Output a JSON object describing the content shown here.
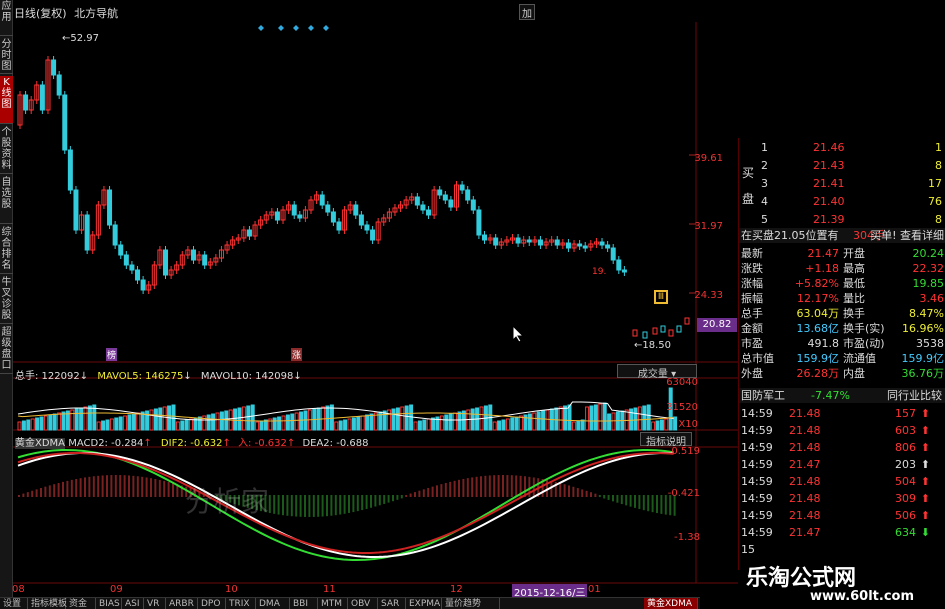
{
  "title": {
    "period": "日线(复权)",
    "stock": "北方导航",
    "right_btn": "加"
  },
  "leftbar": [
    {
      "label": "应用",
      "active": false
    },
    {
      "label": "分时图",
      "active": false
    },
    {
      "label": "K线图",
      "active": true
    },
    {
      "label": "个股资料",
      "active": false
    },
    {
      "label": "自选股",
      "active": false
    },
    {
      "label": "综合排名",
      "active": false
    },
    {
      "label": "牛叉诊股",
      "active": false
    },
    {
      "label": "超级盘口",
      "active": false
    }
  ],
  "price_axis": [
    "39.61",
    "31.97",
    "24.33",
    "20.82"
  ],
  "annotations": {
    "high": "52.97",
    "low": "18.50",
    "tag1": "榜",
    "tag2": "涨",
    "tag3": "19."
  },
  "volume": {
    "legend": {
      "total": "总手: 122092",
      "ma5": "MAVOL5: 146275",
      "ma10": "MAVOL10: 142098"
    },
    "button": "成交量",
    "axis": [
      "63040",
      "31520",
      "X10"
    ]
  },
  "macd": {
    "legend": {
      "name": "黄金XDMA",
      "macd2": "MACD2: -0.284",
      "dif2": "DIF2: -0.632",
      "in": "入: -0.632",
      "dea2": "DEA2: -0.688"
    },
    "button": "指标说明",
    "axis": [
      "0.519",
      "-0.421",
      "-1.38"
    ]
  },
  "months": [
    "08",
    "09",
    "10",
    "11",
    "12",
    "2015-12-16/三",
    "01"
  ],
  "orderbook": {
    "side_label_buy": "买",
    "side_label_pan": "盘",
    "rows": [
      {
        "n": "1",
        "price": "21.46",
        "vol": "1"
      },
      {
        "n": "2",
        "price": "21.43",
        "vol": "8"
      },
      {
        "n": "3",
        "price": "21.41",
        "vol": "17"
      },
      {
        "n": "4",
        "price": "21.40",
        "vol": "76"
      },
      {
        "n": "5",
        "price": "21.39",
        "vol": "8"
      }
    ],
    "notice": "在买盘21.05位置有",
    "notice_vol": "304手",
    "notice_btn": "买单! 查看详细"
  },
  "quote": [
    {
      "l1": "最新",
      "v1": "21.47",
      "l2": "开盘",
      "v2": "20.24",
      "c1": "red",
      "c2": "grn"
    },
    {
      "l1": "涨跌",
      "v1": "+1.18",
      "l2": "最高",
      "v2": "22.32",
      "c1": "red",
      "c2": "red"
    },
    {
      "l1": "涨幅",
      "v1": "+5.82%",
      "l2": "最低",
      "v2": "19.85",
      "c1": "red",
      "c2": "grn"
    },
    {
      "l1": "振幅",
      "v1": "12.17%",
      "l2": "量比",
      "v2": "3.46",
      "c1": "red",
      "c2": "red"
    },
    {
      "l1": "总手",
      "v1": "63.04万",
      "l2": "换手",
      "v2": "8.47%",
      "c1": "yel",
      "c2": "yel"
    },
    {
      "l1": "金额",
      "v1": "13.68亿",
      "l2": "换手(实)",
      "v2": "16.96%",
      "c1": "cyan",
      "c2": "yel"
    },
    {
      "l1": "市盈",
      "v1": "491.8",
      "l2": "市盈(动)",
      "v2": "3538",
      "c1": "wht",
      "c2": "wht"
    },
    {
      "l1": "总市值",
      "v1": "159.9亿",
      "l2": "流通值",
      "v2": "159.9亿",
      "c1": "cyan",
      "c2": "cyan"
    },
    {
      "l1": "外盘",
      "v1": "26.28万",
      "l2": "内盘",
      "v2": "36.76万",
      "c1": "red",
      "c2": "grn"
    }
  ],
  "industry": {
    "name": "国防军工",
    "change": "-7.47%",
    "btn": "同行业比较"
  },
  "ticks": [
    {
      "time": "14:59",
      "price": "21.48",
      "vol": "157",
      "dir": "up",
      "color": "red"
    },
    {
      "time": "14:59",
      "price": "21.48",
      "vol": "603",
      "dir": "up",
      "color": "red"
    },
    {
      "time": "14:59",
      "price": "21.48",
      "vol": "806",
      "dir": "up",
      "color": "red"
    },
    {
      "time": "14:59",
      "price": "21.47",
      "vol": "203",
      "dir": "up",
      "color": "wht"
    },
    {
      "time": "14:59",
      "price": "21.48",
      "vol": "504",
      "dir": "up",
      "color": "red"
    },
    {
      "time": "14:59",
      "price": "21.48",
      "vol": "309",
      "dir": "up",
      "color": "red"
    },
    {
      "time": "14:59",
      "price": "21.48",
      "vol": "506",
      "dir": "up",
      "color": "red"
    },
    {
      "time": "14:59",
      "price": "21.47",
      "vol": "634",
      "dir": "down",
      "color": "grn"
    },
    {
      "time": "15",
      "price": "",
      "vol": "",
      "dir": "",
      "color": "wht"
    },
    {
      "time": "15",
      "price": "",
      "vol": "",
      "dir": "",
      "color": "wht"
    }
  ],
  "bottom_tabs": [
    "设置",
    "指标模板",
    "资金",
    "BIAS",
    "ASI",
    "VR",
    "ARBR",
    "DPO",
    "TRIX",
    "DMA",
    "BBI",
    "MTM",
    "OBV",
    "SAR",
    "EXPMA",
    "量价趋势",
    "黄金XDMA"
  ],
  "watermark": {
    "line1": "乐淘公式网",
    "line2": "www.60lt.com",
    "center": "分析家"
  },
  "colors": {
    "up": "#ff3333",
    "down": "#33ccee",
    "bg": "#000000"
  }
}
